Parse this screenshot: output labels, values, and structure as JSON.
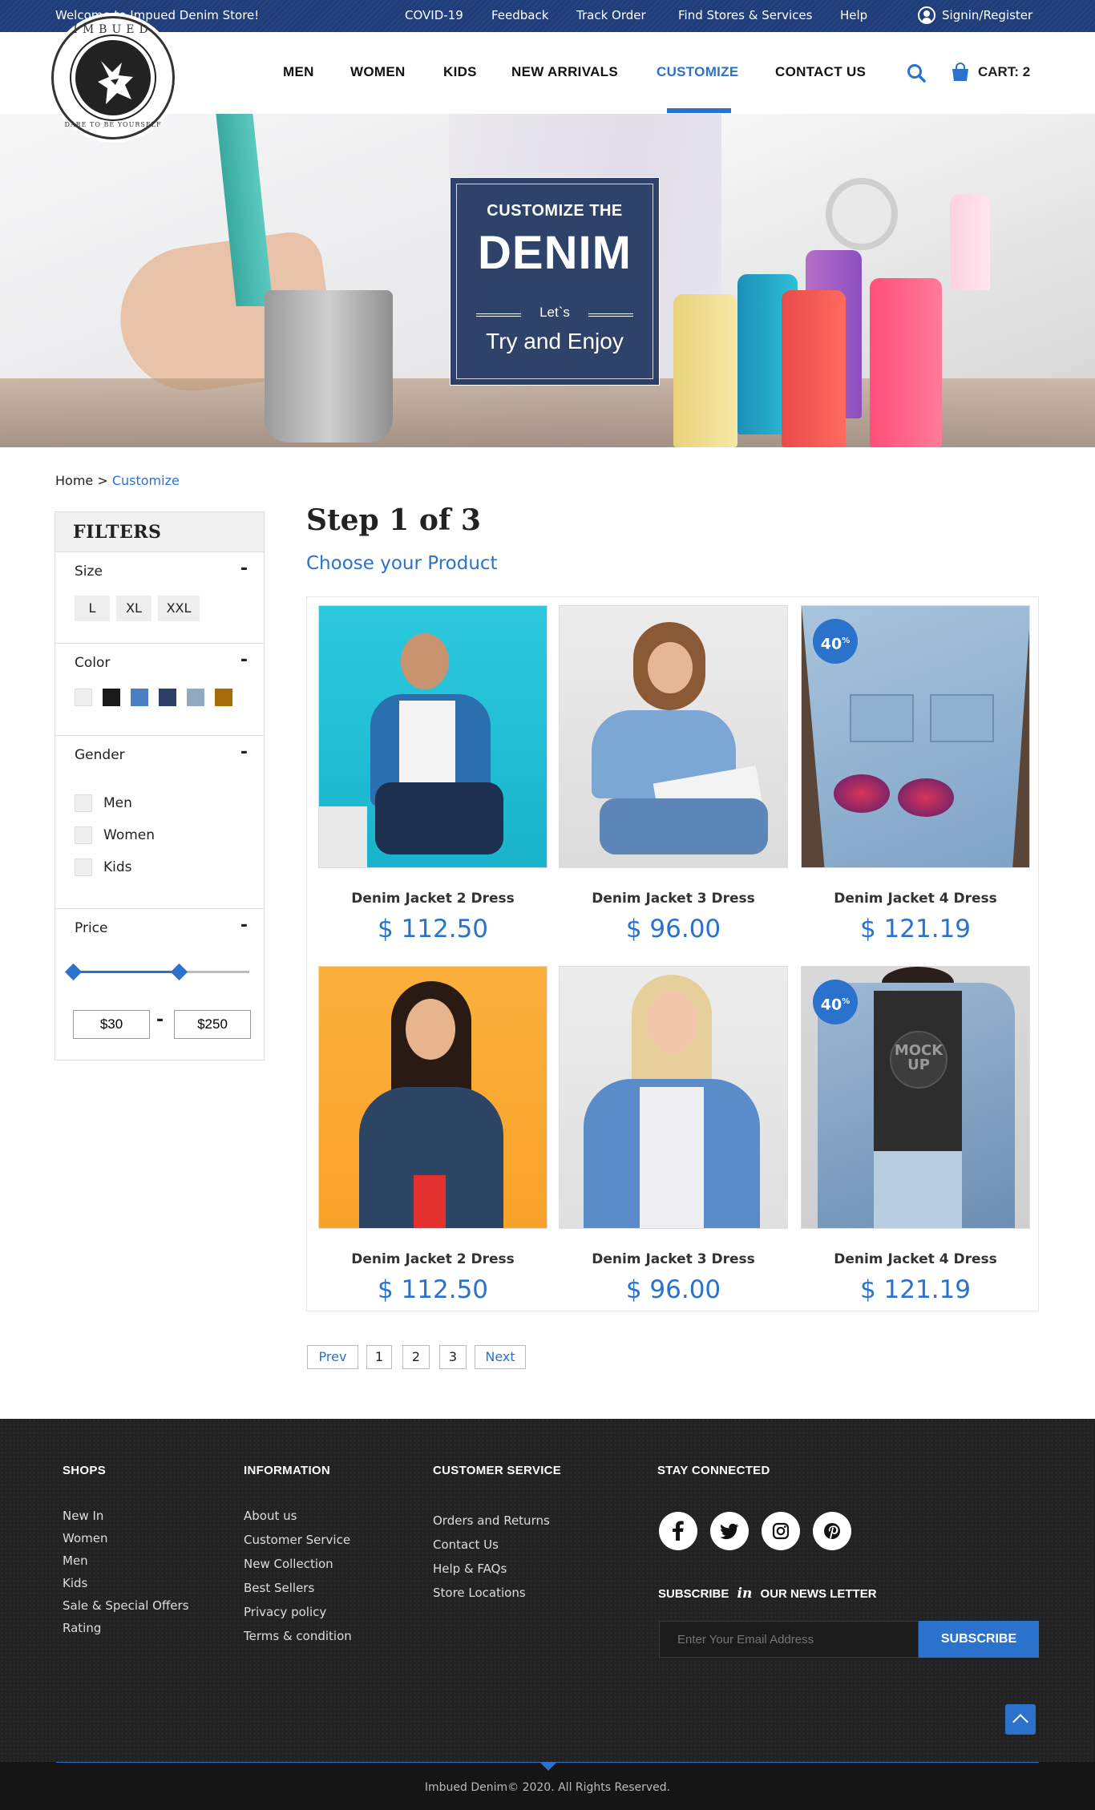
{
  "topbar": {
    "welcome": "Welcome to Impued Denim Store!",
    "links": [
      "COVID-19",
      "Feedback",
      "Track Order",
      "Find Stores & Services",
      "Help"
    ],
    "account": "Signin/Register"
  },
  "logo": {
    "ring_top": "IMBUED",
    "ring_bottom": "DARE TO BE YOURSELF"
  },
  "nav": {
    "items": [
      "MEN",
      "WOMEN",
      "KIDS",
      "NEW ARRIVALS",
      "CUSTOMIZE",
      "CONTACT US"
    ],
    "active": "CUSTOMIZE",
    "cart": "CART: 2"
  },
  "hero": {
    "line1": "CUSTOMIZE THE",
    "line2": "DENIM",
    "line3": "Let`s",
    "line4": "Try and Enjoy"
  },
  "breadcrumb": {
    "home": "Home",
    "separator": ">",
    "current": "Customize"
  },
  "filters": {
    "title": "FILTERS",
    "size": {
      "label": "Size",
      "options": [
        "L",
        "XL",
        "XXL"
      ]
    },
    "color": {
      "label": "Color",
      "swatches": [
        "#f0f0f0",
        "#1a1a1a",
        "#4a7fc4",
        "#2d3f66",
        "#93a9bf",
        "#a86b0a"
      ]
    },
    "gender": {
      "label": "Gender",
      "options": [
        "Men",
        "Women",
        "Kids"
      ]
    },
    "price": {
      "label": "Price",
      "min": "$30",
      "max": "$250",
      "range_low_fraction": 0.0,
      "range_high_fraction": 0.6
    },
    "collapse_symbol": "-"
  },
  "step": {
    "title": "Step 1 of 3",
    "subtitle": "Choose your Product"
  },
  "products": [
    {
      "name": "Denim Jacket 2 Dress",
      "price": "$ 112.50",
      "badge": ""
    },
    {
      "name": "Denim Jacket 3 Dress",
      "price": "$ 96.00",
      "badge": ""
    },
    {
      "name": "Denim Jacket 4 Dress",
      "price": "$ 121.19",
      "badge": "40"
    },
    {
      "name": "Denim Jacket 2 Dress",
      "price": "$ 112.50",
      "badge": ""
    },
    {
      "name": "Denim Jacket 3 Dress",
      "price": "$ 96.00",
      "badge": ""
    },
    {
      "name": "Denim Jacket 4 Dress",
      "price": "$ 121.19",
      "badge": "40"
    }
  ],
  "badge_suffix": "%",
  "mockup_text": "MOCK UP",
  "pagination": {
    "prev": "Prev",
    "pages": [
      "1",
      "2",
      "3"
    ],
    "next": "Next"
  },
  "footer": {
    "shops": {
      "title": "SHOPS",
      "links": [
        "New In",
        "Women",
        "Men",
        "Kids",
        "Sale & Special Offers",
        "Rating"
      ]
    },
    "information": {
      "title": "INFORMATION",
      "links": [
        "About us",
        "Customer Service",
        "New Collection",
        "Best Sellers",
        "Privacy policy",
        "Terms & condition"
      ]
    },
    "customer_service": {
      "title": "CUSTOMER SERVICE",
      "links": [
        "Orders and Returns",
        "Contact Us",
        "Help & FAQs",
        "Store Locations"
      ]
    },
    "stay_connected": {
      "title": "STAY CONNECTED",
      "social": [
        "facebook-icon",
        "twitter-icon",
        "instagram-icon",
        "pinterest-icon"
      ]
    },
    "newsletter": {
      "pre": "SUBSCRIBE",
      "mid": "in",
      "post": "OUR NEWS LETTER",
      "placeholder": "Enter Your Email Address",
      "button": "SUBSCRIBE"
    },
    "copyright": "Imbued Denim© 2020. All Rights Reserved."
  },
  "colors": {
    "brand": "#1f3d7a",
    "accent": "#2a72cc",
    "footer": "#222222"
  }
}
